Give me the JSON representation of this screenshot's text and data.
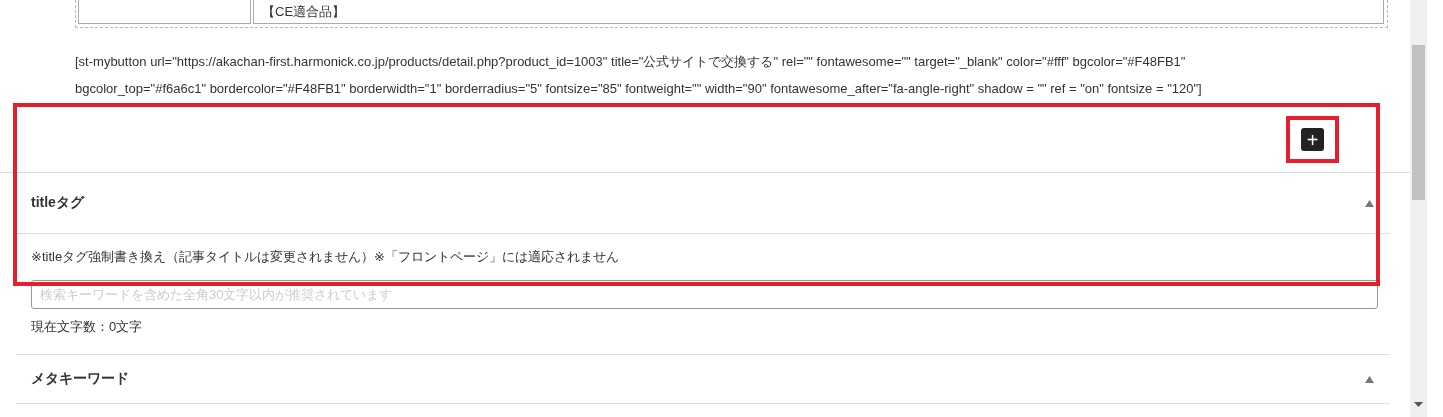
{
  "table": {
    "cell_2": "【CE適合品】"
  },
  "shortcode": {
    "lines": [
      "[st-mybutton url=\"https://akachan-first.harmonick.co.jp/products/detail.php?product_id=1003\" title=\"公式サイトで交換する\" rel=\"\" fontawesome=\"\" target=\"_blank\" color=\"#fff\" bgcolor=\"#F48FB1\"",
      "bgcolor_top=\"#f6a6c1\" bordercolor=\"#F48FB1\" borderwidth=\"1\" borderradius=\"5\" fontsize=\"85\" fontweight=\"\" width=\"90\" fontawesome_after=\"fa-angle-right\" shadow = \"\" ref = \"on\" fontsize = \"120\"]"
    ]
  },
  "add_button": {
    "label": "+"
  },
  "sections": [
    {
      "title": "titleタグ",
      "note": "※titleタグ強制書き換え（記事タイトルは変更されません）※「フロントページ」には適応されません",
      "field": {
        "placeholder": "検索キーワードを含めた全角30文字以内が推奨されています"
      },
      "counter": "現在文字数：0文字"
    },
    {
      "title": "メタキーワード"
    }
  ]
}
